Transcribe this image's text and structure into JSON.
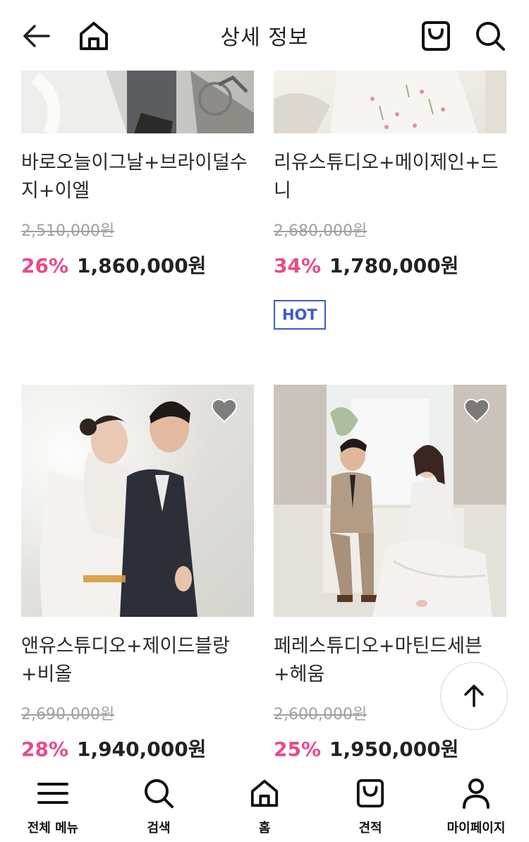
{
  "header": {
    "title": "상세 정보"
  },
  "products": [
    {
      "name": "바로오늘이그날+브라이덜수지+이엘",
      "original_price": "2,510,000원",
      "discount": "26%",
      "price": "1,860,000원"
    },
    {
      "name": "리유스튜디오+메이제인+드니",
      "original_price": "2,680,000원",
      "discount": "34%",
      "price": "1,780,000원",
      "badge": "HOT"
    },
    {
      "name": "앤유스튜디오+제이드블랑+비올",
      "original_price": "2,690,000원",
      "discount": "28%",
      "price": "1,940,000원"
    },
    {
      "name": "페레스튜디오+마틴드세븐+헤움",
      "original_price": "2,600,000원",
      "discount": "25%",
      "price": "1,950,000원"
    }
  ],
  "bottom_nav": {
    "items": [
      {
        "label": "전체 메뉴",
        "icon": "menu-icon"
      },
      {
        "label": "검색",
        "icon": "search-icon"
      },
      {
        "label": "홈",
        "icon": "home-icon"
      },
      {
        "label": "견적",
        "icon": "bag-icon"
      },
      {
        "label": "마이페이지",
        "icon": "user-icon"
      }
    ]
  },
  "colors": {
    "discount": "#e84a8c",
    "badge": "#3d5cc7",
    "text": "#222222",
    "strike": "#a0a0a0"
  }
}
